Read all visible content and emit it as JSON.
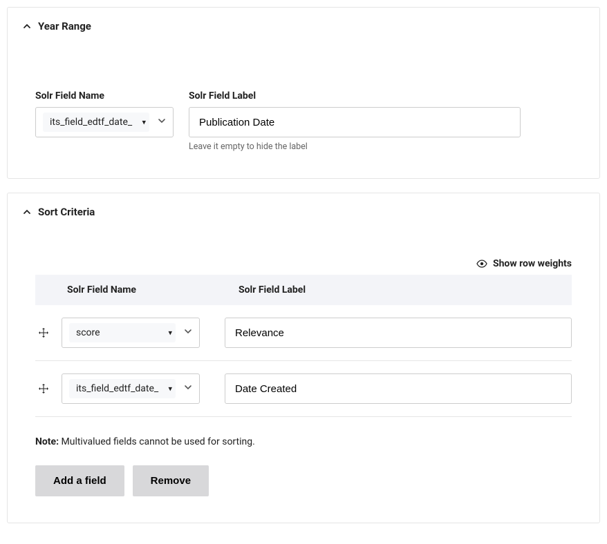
{
  "yearRange": {
    "title": "Year Range",
    "fieldNameLabel": "Solr Field Name",
    "fieldNameValue": "its_field_edtf_date_",
    "fieldLabelLabel": "Solr Field Label",
    "fieldLabelValue": "Publication Date",
    "fieldLabelHint": "Leave it empty to hide the label"
  },
  "sortCriteria": {
    "title": "Sort Criteria",
    "showWeightsLabel": "Show row weights",
    "headers": {
      "name": "Solr Field Name",
      "label": "Solr Field Label"
    },
    "rows": [
      {
        "fieldName": "score",
        "fieldLabel": "Relevance"
      },
      {
        "fieldName": "its_field_edtf_date_",
        "fieldLabel": "Date Created"
      }
    ],
    "noteStrong": "Note:",
    "noteText": " Multivalued fields cannot be used for sorting.",
    "addFieldLabel": "Add a field",
    "removeLabel": "Remove"
  }
}
